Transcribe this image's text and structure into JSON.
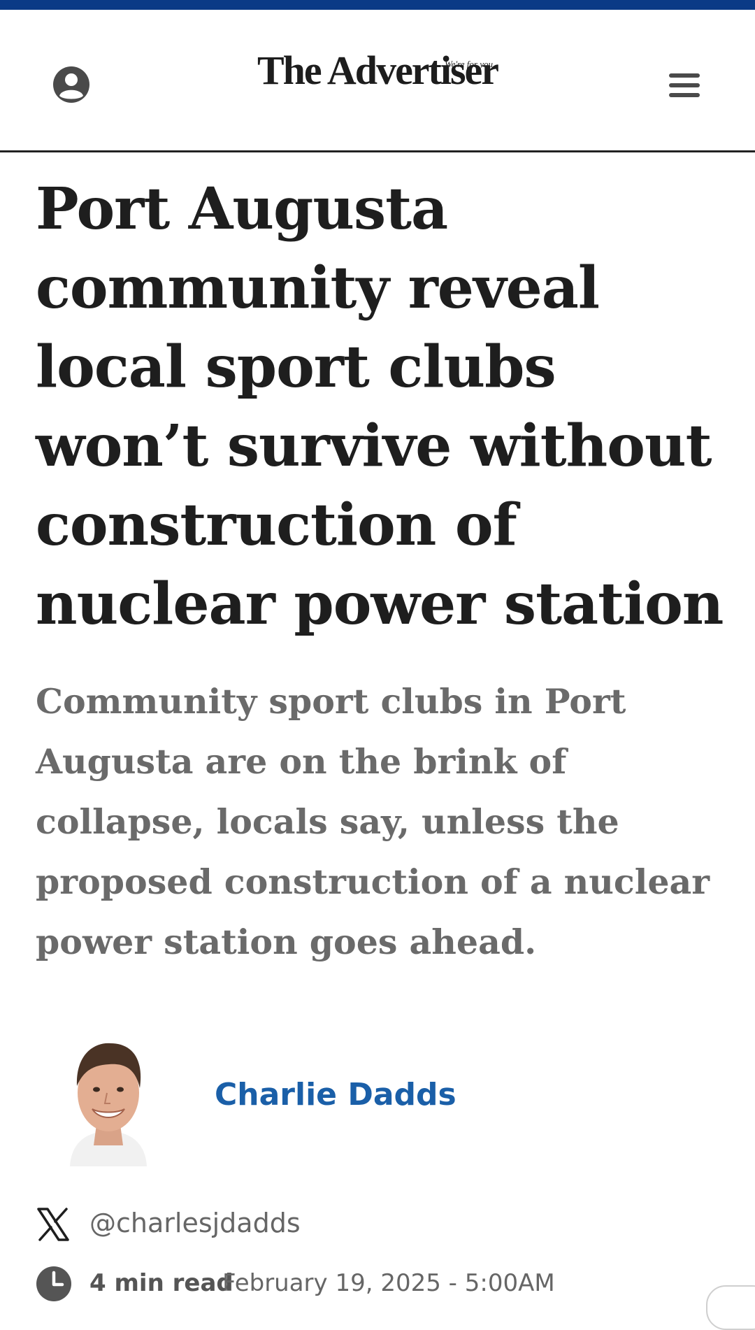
{
  "colors": {
    "top_bar": "#0a3a86",
    "author_link": "#1a5fa8",
    "headline": "#1e1e1e",
    "standfirst": "#6a6a6a"
  },
  "header": {
    "logo_text": "The Advertiser",
    "logo_tagline": "We're for you",
    "account_icon": "user-circle-icon",
    "menu_icon": "hamburger-menu-icon"
  },
  "article": {
    "headline": "Port Augusta community reveal local sport clubs won’t survive without construction of nuclear power station",
    "standfirst": "Community sport clubs in Port Augusta are on the brink of collapse, locals say, unless the proposed construction of a nuclear power station goes ahead.",
    "author": {
      "name": "Charlie Dadds",
      "x_handle": "@charlesjdadds",
      "photo": "author-headshot"
    },
    "meta": {
      "read_time": "4 min read",
      "published": "February 19, 2025 - 5:00AM"
    }
  }
}
